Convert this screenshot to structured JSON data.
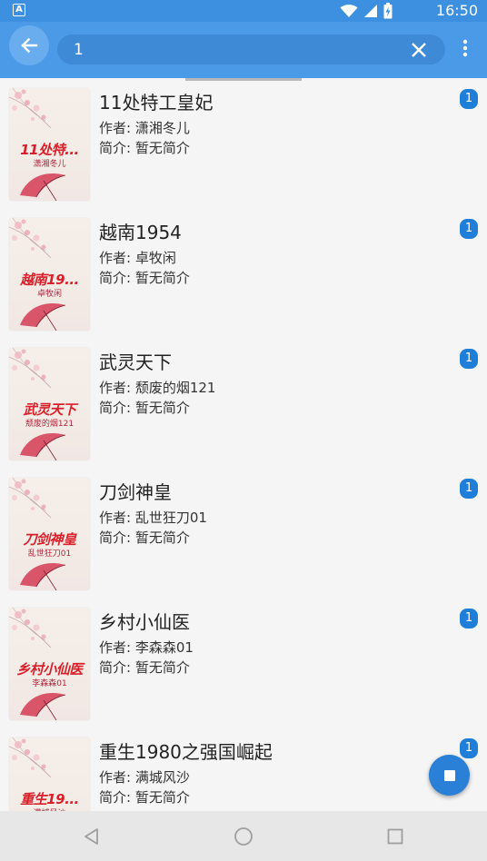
{
  "status_bar": {
    "time": "16:50",
    "app_badge": "A"
  },
  "toolbar": {
    "search_value": "1",
    "back_icon": "arrow-left-icon",
    "clear_icon": "close-icon",
    "more_icon": "more-vertical-icon"
  },
  "books": [
    {
      "title": "11处特工皇妃",
      "author": "作者: 潇湘冬儿",
      "intro": "简介: 暂无简介",
      "cover_title": "11处特...",
      "cover_author": "潇湘冬儿",
      "count": "1"
    },
    {
      "title": "越南1954",
      "author": "作者: 卓牧闲",
      "intro": "简介: 暂无简介",
      "cover_title": "越南19...",
      "cover_author": "卓牧闲",
      "count": "1"
    },
    {
      "title": "武灵天下",
      "author": "作者: 颓废的烟121",
      "intro": "简介: 暂无简介",
      "cover_title": "武灵天下",
      "cover_author": "颓废的烟121",
      "count": "1"
    },
    {
      "title": "刀剑神皇",
      "author": "作者: 乱世狂刀01",
      "intro": "简介: 暂无简介",
      "cover_title": "刀剑神皇",
      "cover_author": "乱世狂刀01",
      "count": "1"
    },
    {
      "title": "乡村小仙医",
      "author": "作者: 李森森01",
      "intro": "简介: 暂无简介",
      "cover_title": "乡村小仙医",
      "cover_author": "李森森01",
      "count": "1"
    },
    {
      "title": "重生1980之强国崛起",
      "author": "作者: 满城风沙",
      "intro": "简介: 暂无简介",
      "cover_title": "重生19...",
      "cover_author": "满城风沙",
      "count": "1"
    }
  ],
  "fab": {
    "icon": "stop-icon"
  },
  "nav_bar": {
    "back_icon": "nav-back-icon",
    "home_icon": "nav-home-icon",
    "recents_icon": "nav-recents-icon"
  },
  "colors": {
    "primary": "#4a9ae8",
    "accent": "#1f7ed8",
    "cover_text": "#d9202a"
  }
}
